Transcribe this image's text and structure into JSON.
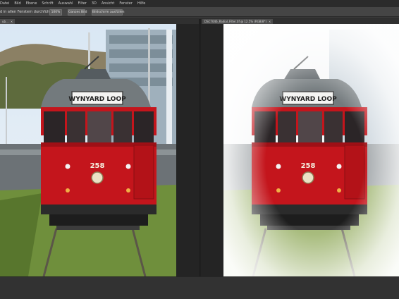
{
  "menu": [
    "Datei",
    "Bild",
    "Ebene",
    "Schrift",
    "Auswahl",
    "Filter",
    "3D",
    "Ansicht",
    "Fenster",
    "Hilfe"
  ],
  "options": {
    "scroll_all_label": "d in allen Fenstern durchführen",
    "zoom_100_label": "100%",
    "fit_screen_label": "Ganzes Bild",
    "fill_screen_label": "Bildschirm ausfüllen"
  },
  "documents": {
    "left": {
      "tab_title": "ub...",
      "close": "×"
    },
    "right": {
      "tab_title": "DSC7046_Radial_Filter.tif @ 12.5% (RGB/8*)",
      "close": "×"
    }
  },
  "photo": {
    "destination_sign": "WYNYARD LOOP",
    "number": "258"
  },
  "colors": {
    "tram_red": "#c4151c",
    "roof_gray": "#6f7679",
    "grass": "#6f8f3c"
  }
}
